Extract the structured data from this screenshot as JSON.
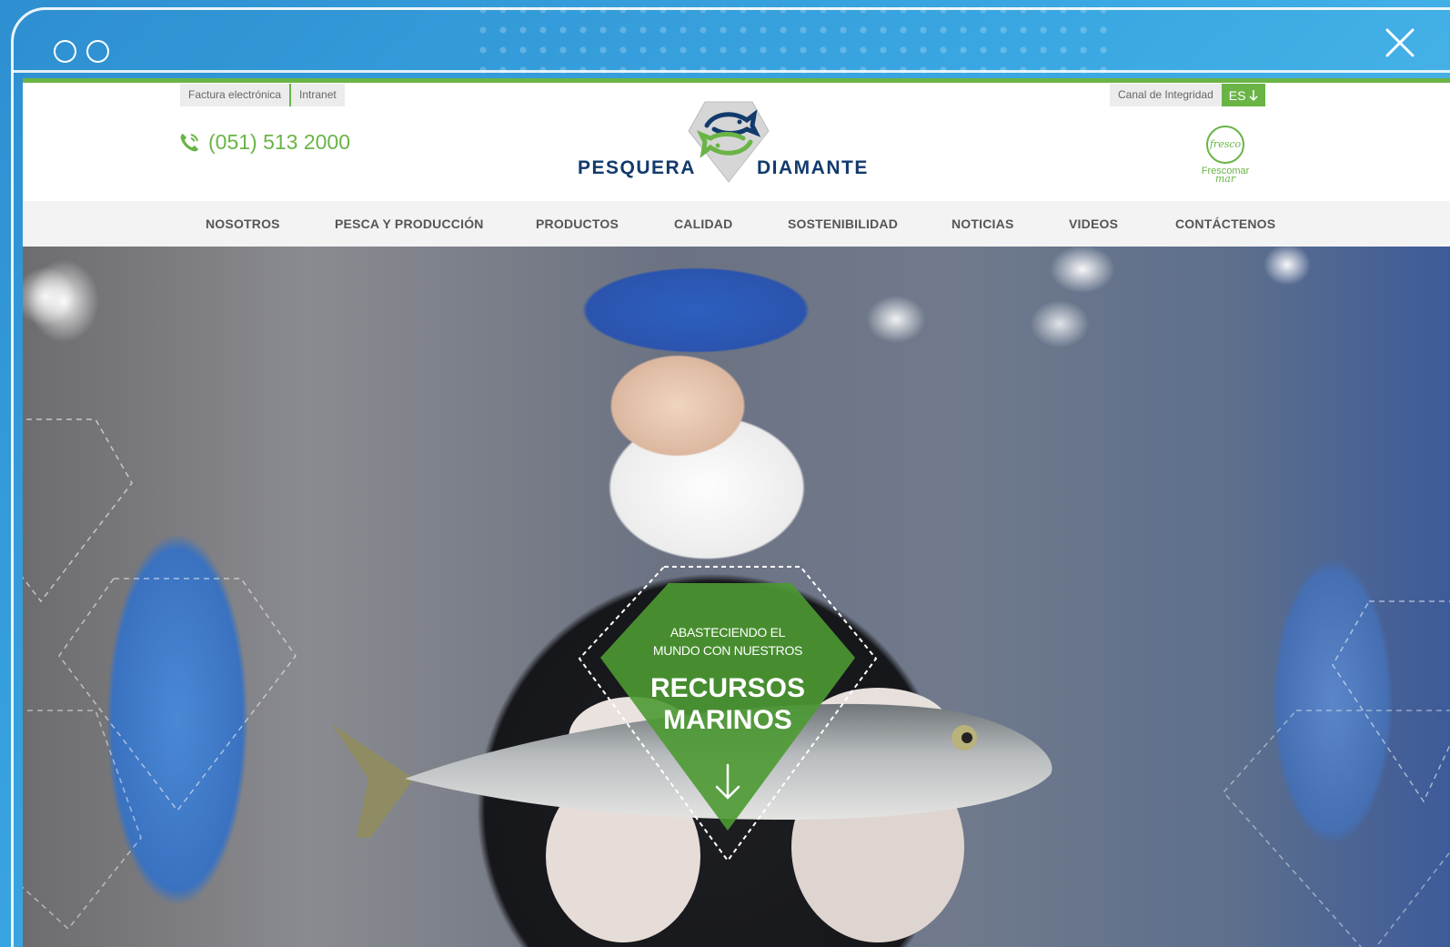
{
  "window": {
    "close_icon": "close-icon"
  },
  "utility": {
    "left_links": [
      "Factura electrónica",
      "Intranet"
    ],
    "integrity_label": "Canal de Integridad",
    "language": "ES"
  },
  "header": {
    "phone": "(051) 513 2000",
    "logo_left": "PESQUERA",
    "logo_right": "DIAMANTE",
    "frescomar_logo_text": "fresco mar",
    "frescomar_label": "Frescomar"
  },
  "nav": {
    "items": [
      "NOSOTROS",
      "PESCA Y PRODUCCIÓN",
      "PRODUCTOS",
      "CALIDAD",
      "SOSTENIBILIDAD",
      "NOTICIAS",
      "VIDEOS",
      "CONTÁCTENOS"
    ]
  },
  "hero": {
    "subtitle_line1": "ABASTECIENDO EL",
    "subtitle_line2": "MUNDO CON NUESTROS",
    "title_line1": "RECURSOS",
    "title_line2": "MARINOS"
  },
  "colors": {
    "brand_green": "#6ab446",
    "brand_navy": "#123a6c",
    "hero_diamond": "#4c9a33"
  }
}
